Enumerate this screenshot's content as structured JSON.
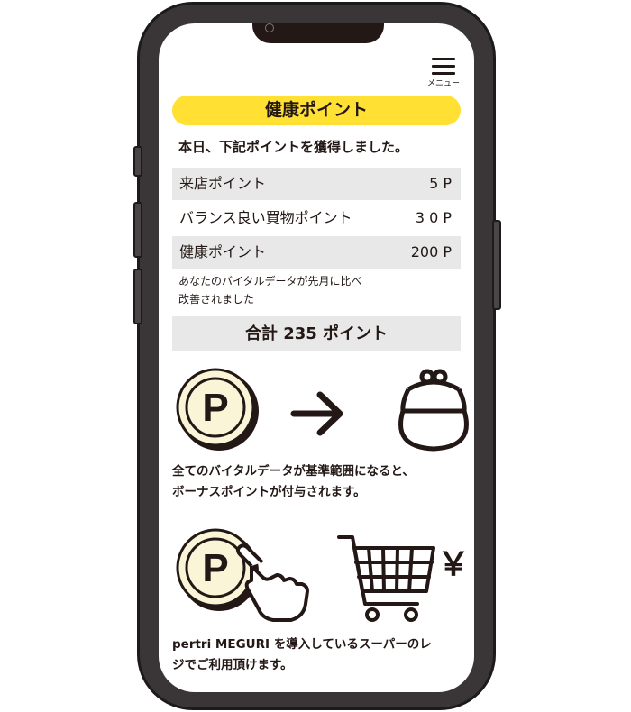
{
  "menu": {
    "label": "メニュー"
  },
  "title": "健康ポイント",
  "headline": "本日、下記ポイントを獲得しました。",
  "points": [
    {
      "label": "来店ポイント",
      "value": "5 P"
    },
    {
      "label": "バランス良い買物ポイント",
      "value": "3 0 P"
    },
    {
      "label": "健康ポイント",
      "value": "200 P"
    }
  ],
  "note_line1": "あなたのバイタルデータが先月に比べ",
  "note_line2": "改善されました",
  "total": "合計 235 ポイント",
  "coin_letter": "P",
  "yen_symbol": "￥",
  "info_line1": "全てのバイタルデータが基準範囲になると、",
  "info_line2": "ボーナスポイントが付与されます。",
  "footer_line1": "pertri MEGURI を導入しているスーパーのレ",
  "footer_line2": "ジでご利用頂けます。"
}
